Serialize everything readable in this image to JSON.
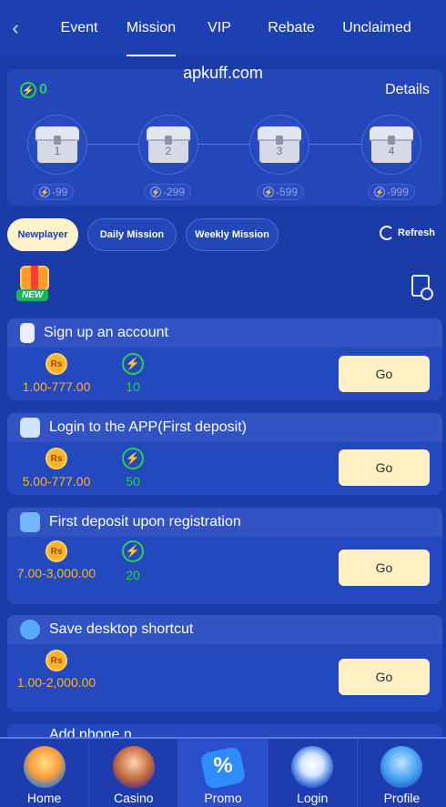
{
  "nav": {
    "back_icon": "chevron-left-icon",
    "tabs": [
      {
        "label": "Event"
      },
      {
        "label": "Mission"
      },
      {
        "label": "VIP"
      },
      {
        "label": "Rebate"
      },
      {
        "label": "Unclaimed"
      }
    ],
    "active_tab": "Mission"
  },
  "watermark": "apkuff.com",
  "progress": {
    "energy_value": "0",
    "details_label": "Details",
    "chests": [
      {
        "number": "1",
        "requirement": "-99"
      },
      {
        "number": "2",
        "requirement": "-299"
      },
      {
        "number": "3",
        "requirement": "-599"
      },
      {
        "number": "4",
        "requirement": "-999"
      }
    ]
  },
  "categories": {
    "items": [
      {
        "label": "Newplayer"
      },
      {
        "label": "Daily Mission"
      },
      {
        "label": "Weekly Mission"
      }
    ],
    "active": "Newplayer",
    "refresh_label": "Refresh"
  },
  "new_badge_label": "NEW",
  "tasks": [
    {
      "title": "Sign up an account",
      "icon": "phone-check-icon",
      "amount": "1.00-777.00",
      "energy": "10",
      "button": "Go"
    },
    {
      "title": "Login to the APP(First deposit)",
      "icon": "login-app-icon",
      "amount": "5.00-777.00",
      "energy": "50",
      "button": "Go"
    },
    {
      "title": "First deposit upon registration",
      "icon": "wallet-icon",
      "amount": "7.00-3,000.00",
      "energy": "20",
      "button": "Go"
    },
    {
      "title": "Save desktop shortcut",
      "icon": "globe-icon",
      "amount": "1.00-2,000.00",
      "energy": "",
      "button": "Go"
    }
  ],
  "next_task_peek": "Add phone n",
  "coin_symbol": "Rs",
  "bottom_nav": [
    {
      "label": "Home",
      "icon": "home-icon"
    },
    {
      "label": "Casino",
      "icon": "casino-icon"
    },
    {
      "label": "Promo",
      "icon": "promo-icon"
    },
    {
      "label": "Login",
      "icon": "login-icon"
    },
    {
      "label": "Profile",
      "icon": "profile-icon"
    }
  ],
  "active_bottom": "Promo",
  "colors": {
    "background": "#1a3ba8",
    "card": "#2448bd",
    "button": "#fff1c4",
    "coin": "#ffb22a",
    "energy": "#2bd14a"
  }
}
